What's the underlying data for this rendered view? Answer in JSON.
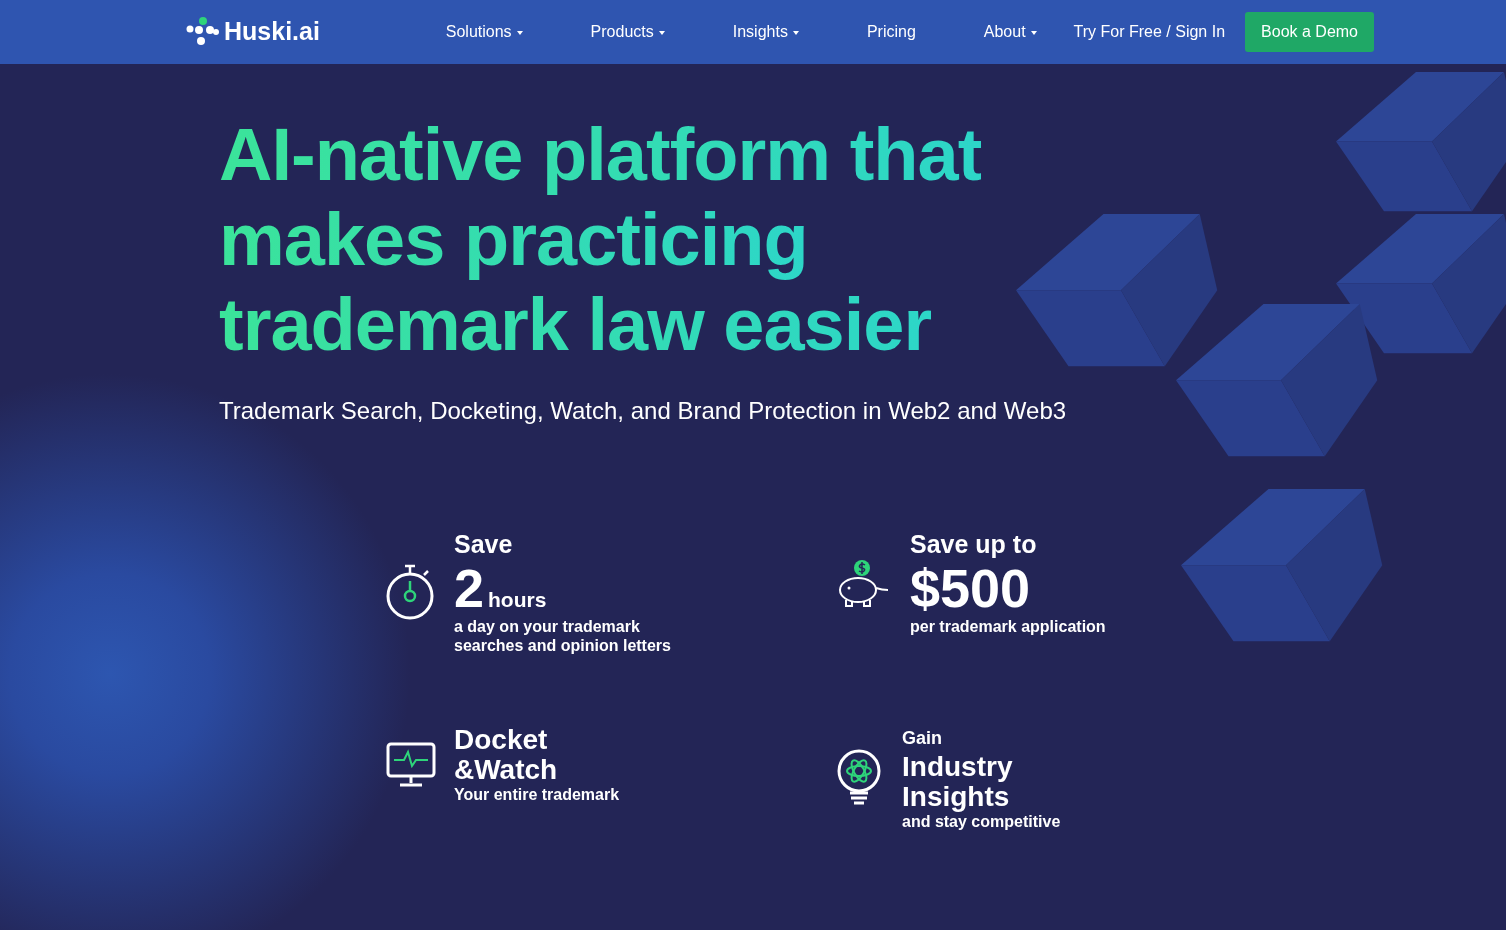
{
  "navbar": {
    "brand": "Huski.ai",
    "items": [
      {
        "label": "Solutions",
        "dropdown": true
      },
      {
        "label": "Products",
        "dropdown": true
      },
      {
        "label": "Insights",
        "dropdown": true
      },
      {
        "label": "Pricing",
        "dropdown": false
      },
      {
        "label": "About",
        "dropdown": true
      }
    ],
    "sign_in": "Try For Free / Sign In",
    "cta": "Book a Demo"
  },
  "hero": {
    "headline": [
      "AI-native platform that",
      "makes practicing",
      "trademark law easier"
    ],
    "subtitle": "Trademark Search, Docketing, Watch, and Brand Protection in Web2 and Web3"
  },
  "stats": [
    {
      "kind": "number",
      "lead": "Save",
      "value": "2",
      "unit": "hours",
      "detail": "a day on your trademark searches and opinion letters"
    },
    {
      "kind": "number",
      "lead": "Save up to",
      "value": "$500",
      "detail": "per trademark application"
    },
    {
      "kind": "title",
      "value": "Docket &Watch",
      "detail": "Your entire trademark"
    },
    {
      "kind": "title",
      "lead": "Gain",
      "value": "Industry Insights",
      "detail": "and stay competitive"
    }
  ]
}
